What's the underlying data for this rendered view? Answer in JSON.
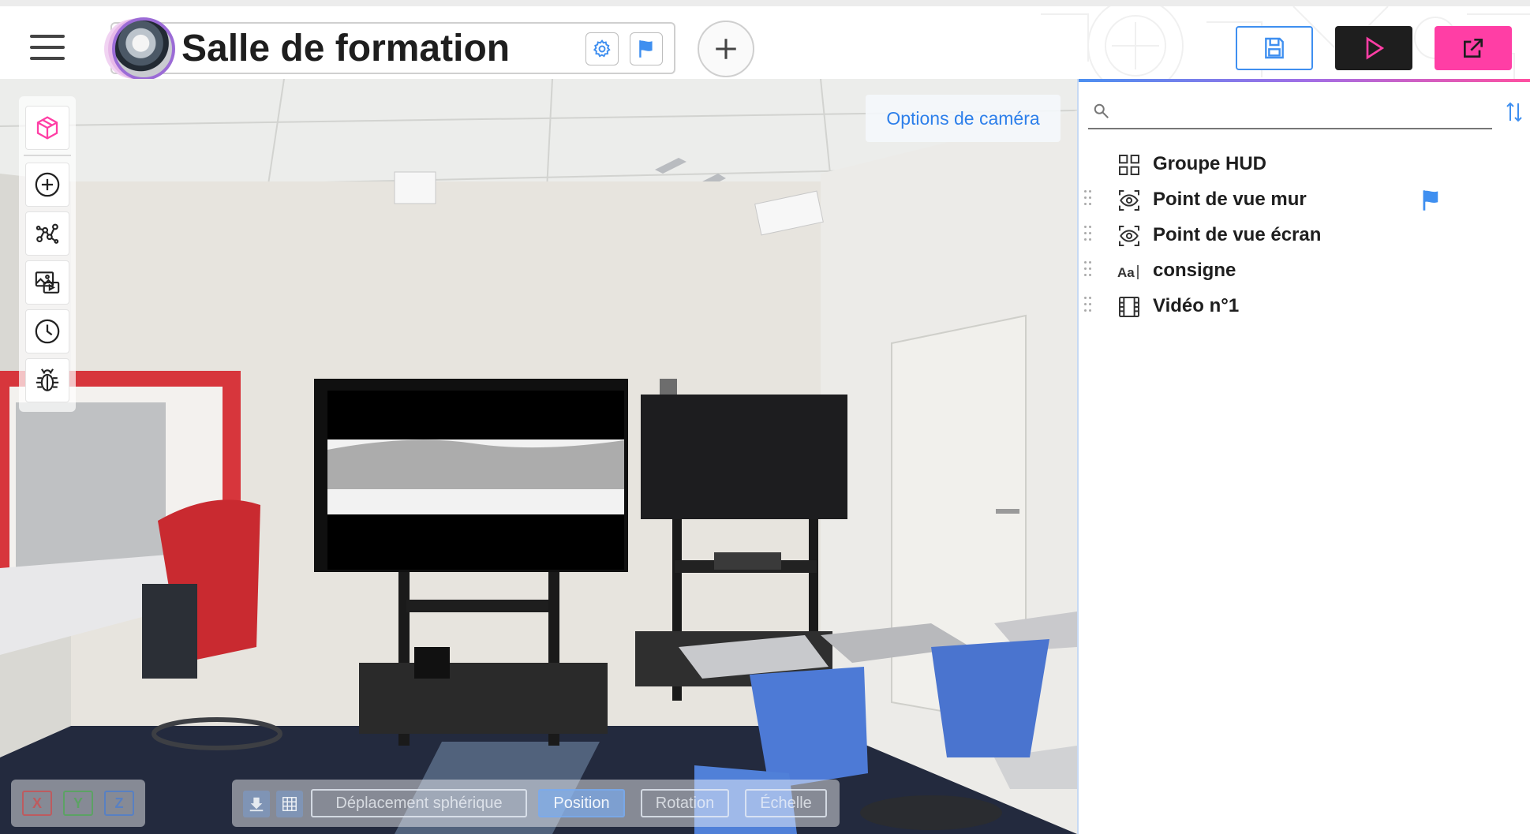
{
  "header": {
    "scene_title": "Salle de formation",
    "colors": {
      "accent": "#3f8ff0",
      "play": "#1e1e1e",
      "export": "#ff3ea5"
    }
  },
  "viewport": {
    "camera_options_label": "Options de caméra",
    "axes": [
      "X",
      "Y",
      "Z"
    ],
    "transform_modes": [
      {
        "label": "Déplacement sphérique",
        "active": false
      },
      {
        "label": "Position",
        "active": true
      },
      {
        "label": "Rotation",
        "active": false
      },
      {
        "label": "Échelle",
        "active": false
      }
    ]
  },
  "panel": {
    "search": {
      "value": "",
      "placeholder": ""
    },
    "layers": [
      {
        "label": "Groupe HUD",
        "icon": "grid-icon",
        "draggable": false,
        "flag": false
      },
      {
        "label": "Point de vue mur",
        "icon": "eye-viewpoint-icon",
        "draggable": true,
        "flag": true
      },
      {
        "label": "Point de vue écran",
        "icon": "eye-viewpoint-icon",
        "draggable": true,
        "flag": false
      },
      {
        "label": "consigne",
        "icon": "text-icon",
        "draggable": true,
        "flag": false
      },
      {
        "label": "Vidéo n°1",
        "icon": "film-icon",
        "draggable": true,
        "flag": false
      }
    ]
  }
}
